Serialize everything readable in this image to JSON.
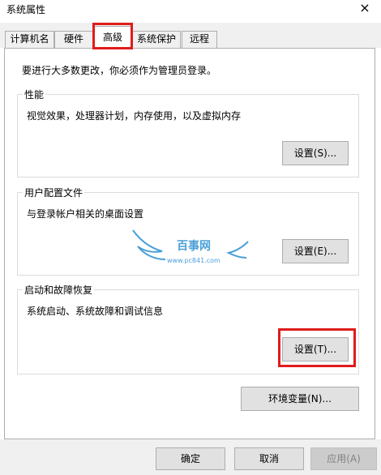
{
  "window": {
    "title": "系统属性",
    "close_glyph": "×"
  },
  "tabs": [
    {
      "label": "计算机名"
    },
    {
      "label": "硬件"
    },
    {
      "label": "高级"
    },
    {
      "label": "系统保护"
    },
    {
      "label": "远程"
    }
  ],
  "active_tab": "高级",
  "intro_text": "要进行大多数更改，你必须作为管理员登录。",
  "groups": {
    "performance": {
      "title": "性能",
      "description": "视觉效果，处理器计划，内存使用，以及虚拟内存",
      "button": "设置(S)..."
    },
    "user_profiles": {
      "title": "用户配置文件",
      "description": "与登录帐户相关的桌面设置",
      "button": "设置(E)..."
    },
    "startup_recovery": {
      "title": "启动和故障恢复",
      "description": "系统启动、系统故障和调试信息",
      "button": "设置(T)..."
    }
  },
  "env_button": "环境变量(N)...",
  "footer": {
    "ok": "确定",
    "cancel": "取消",
    "apply": "应用(A)"
  },
  "watermark": {
    "name": "百事网",
    "url": "www.pc841.com"
  },
  "colors": {
    "highlight": "#e01b1b",
    "watermark": "#4a9fd8"
  }
}
